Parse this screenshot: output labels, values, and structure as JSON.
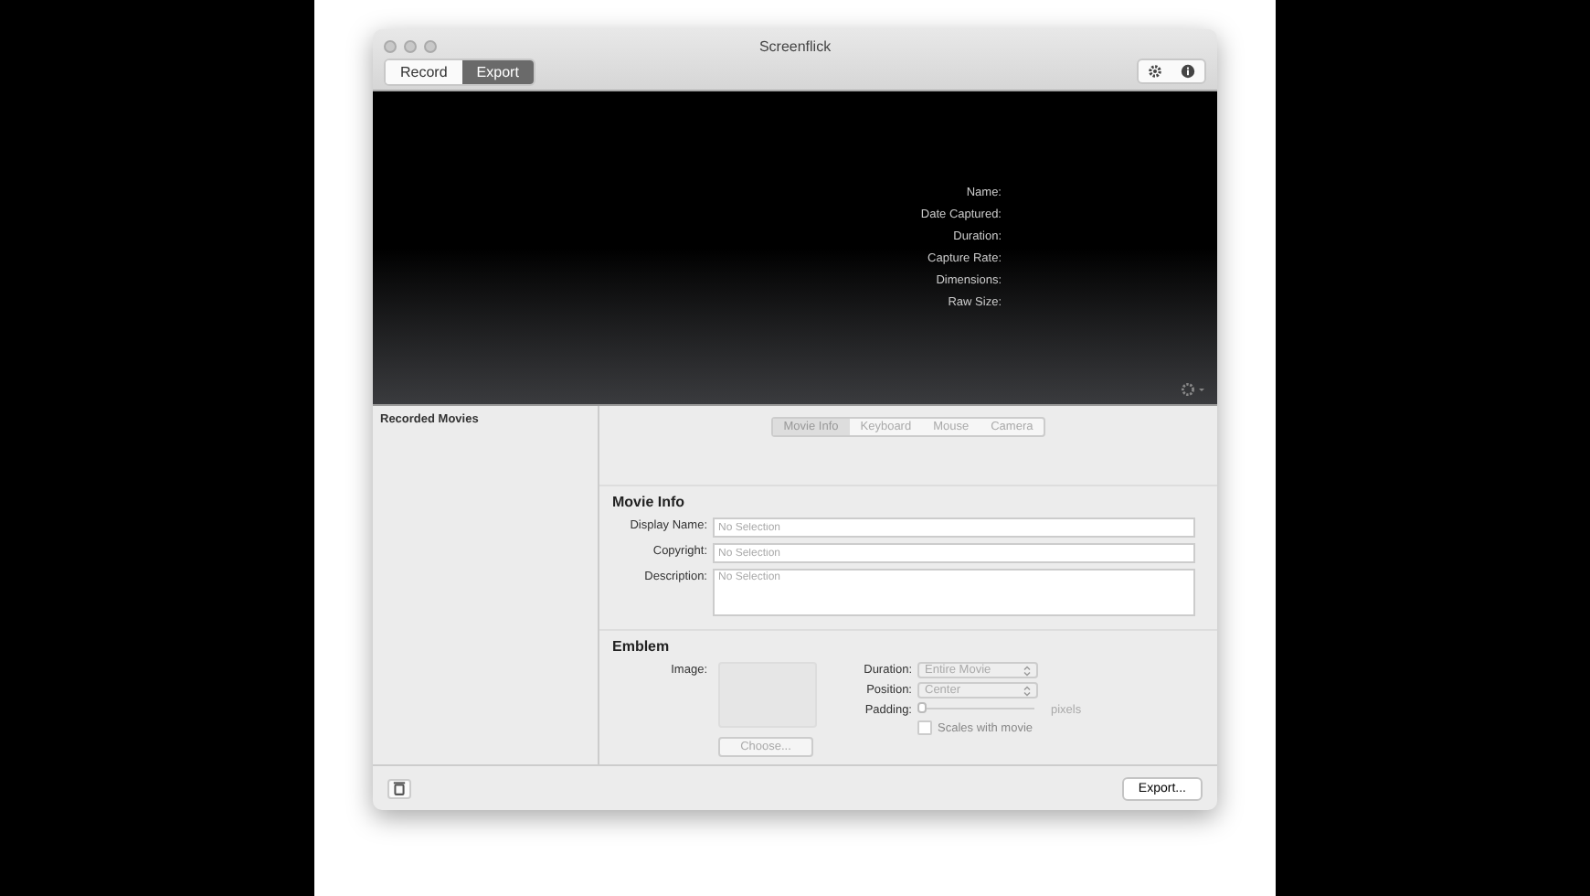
{
  "window": {
    "title": "Screenflick"
  },
  "mode_tabs": [
    {
      "label": "Record",
      "selected": false
    },
    {
      "label": "Export",
      "selected": true
    }
  ],
  "preview": {
    "fields": [
      {
        "label": "Name:"
      },
      {
        "label": "Date Captured:"
      },
      {
        "label": "Duration:"
      },
      {
        "label": "Capture Rate:"
      },
      {
        "label": "Dimensions:"
      },
      {
        "label": "Raw Size:"
      }
    ]
  },
  "sidebar": {
    "title": "Recorded Movies"
  },
  "section_tabs": [
    {
      "label": "Movie Info",
      "selected": true
    },
    {
      "label": "Keyboard",
      "selected": false
    },
    {
      "label": "Mouse",
      "selected": false
    },
    {
      "label": "Camera",
      "selected": false
    }
  ],
  "movie_info": {
    "title": "Movie Info",
    "fields": [
      {
        "label": "Display Name:",
        "placeholder": "No Selection",
        "kind": "line"
      },
      {
        "label": "Copyright:",
        "placeholder": "No Selection",
        "kind": "line"
      },
      {
        "label": "Description:",
        "placeholder": "No Selection",
        "kind": "area"
      }
    ]
  },
  "emblem": {
    "title": "Emblem",
    "image_label": "Image:",
    "choose_button": {
      "label": "Choose...",
      "disabled": true
    },
    "duration": {
      "label": "Duration:",
      "value": "Entire Movie"
    },
    "position": {
      "label": "Position:",
      "value": "Center"
    },
    "padding": {
      "label": "Padding:",
      "level": 0,
      "unit": "pixels"
    },
    "scales": {
      "label": "Scales with movie",
      "checked": false
    }
  },
  "export_button": "Export..."
}
